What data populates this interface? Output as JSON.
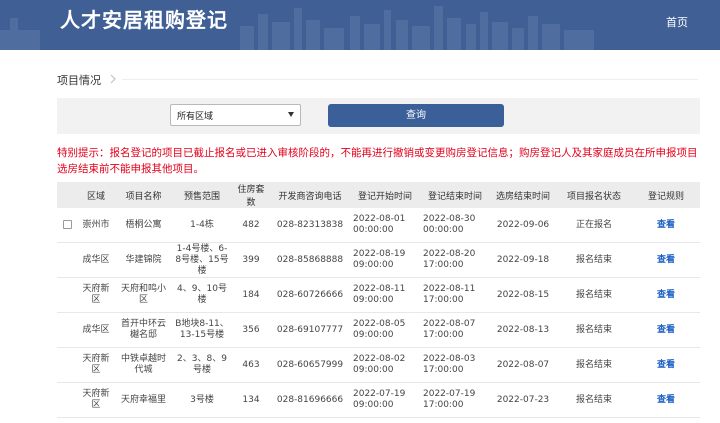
{
  "header": {
    "title": "人才安居租购登记",
    "home": "首页"
  },
  "section": {
    "title": "项目情况"
  },
  "filter": {
    "region_selected": "所有区域",
    "query_label": "查询"
  },
  "notice": {
    "line1": "特别提示：报名登记的项目已截止报名或已进入审核阶段的，不能再进行撤销或变更购房登记信息；购房登记人及其家庭成员在所申报项目",
    "line2": "选房结束前不能申报其他项目。"
  },
  "table": {
    "headers": [
      "区域",
      "项目名称",
      "预售范围",
      "住房套数",
      "开发商咨询电话",
      "登记开始时间",
      "登记结束时间",
      "选房结束时间",
      "项目报名状态",
      "登记规则"
    ],
    "rows": [
      {
        "region": "崇州市",
        "name": "梧桐公寓",
        "scope": "1-4栋",
        "units": "482",
        "phone": "028-82313838",
        "start": "2022-08-01 00:00:00",
        "end": "2022-08-30 00:00:00",
        "select_end": "2022-09-06",
        "status": "正在报名",
        "rule": "查看"
      },
      {
        "region": "成华区",
        "name": "华建锦院",
        "scope": "1-4号楼、6-8号楼、15号楼",
        "units": "399",
        "phone": "028-85868888",
        "start": "2022-08-19 09:00:00",
        "end": "2022-08-20 17:00:00",
        "select_end": "2022-09-18",
        "status": "报名结束",
        "rule": "查看"
      },
      {
        "region": "天府新区",
        "name": "天府和鸣小区",
        "scope": "4、9、10号楼",
        "units": "184",
        "phone": "028-60726666",
        "start": "2022-08-11 09:00:00",
        "end": "2022-08-11 17:00:00",
        "select_end": "2022-08-15",
        "status": "报名结束",
        "rule": "查看"
      },
      {
        "region": "成华区",
        "name": "首开中环云樾名邸",
        "scope": "B地块8-11、13-15号楼",
        "units": "356",
        "phone": "028-69107777",
        "start": "2022-08-05 09:00:00",
        "end": "2022-08-07 17:00:00",
        "select_end": "2022-08-13",
        "status": "报名结束",
        "rule": "查看"
      },
      {
        "region": "天府新区",
        "name": "中铁卓越时代城",
        "scope": "2、3、8、9号楼",
        "units": "463",
        "phone": "028-60657999",
        "start": "2022-08-02 09:00:00",
        "end": "2022-08-03 17:00:00",
        "select_end": "2022-08-07",
        "status": "报名结束",
        "rule": "查看"
      },
      {
        "region": "天府新区",
        "name": "天府幸福里",
        "scope": "3号楼",
        "units": "134",
        "phone": "028-81696666",
        "start": "2022-07-19 09:00:00",
        "end": "2022-07-19 17:00:00",
        "select_end": "2022-07-23",
        "status": "报名结束",
        "rule": "查看"
      }
    ]
  }
}
